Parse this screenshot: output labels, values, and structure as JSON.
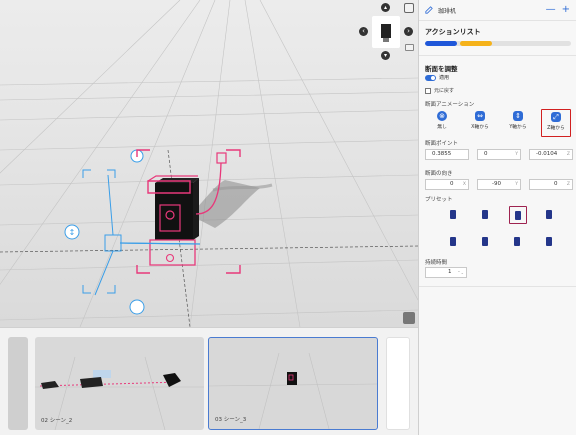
{
  "header": {
    "object_name": "珈琲机",
    "minus_label": "—",
    "plus_label": "+"
  },
  "action_list": {
    "title": "アクションリスト",
    "segment1": 0.22,
    "segment2": 0.22
  },
  "section": {
    "title": "断面を調整",
    "apply_label": "適用",
    "apply_on": true,
    "reset_label": "元に戻す",
    "animation_label": "断面アニメーション",
    "animations": [
      {
        "label": "無し",
        "icon": "none-icon"
      },
      {
        "label": "X軸から",
        "icon": "x-axis-icon"
      },
      {
        "label": "Y軸から",
        "icon": "y-axis-icon"
      },
      {
        "label": "Z軸から",
        "icon": "z-axis-icon",
        "selected": true
      }
    ],
    "point_label": "断面ポイント",
    "point": [
      {
        "value": "0.3855",
        "unit": ""
      },
      {
        "value": "0",
        "unit": "Y"
      },
      {
        "value": "-0.0104",
        "unit": "Z"
      }
    ],
    "direction_label": "断面の向き",
    "direction": [
      {
        "value": "0",
        "unit": "X"
      },
      {
        "value": "-90",
        "unit": "Y"
      },
      {
        "value": "0",
        "unit": "Z"
      }
    ],
    "preset_label": "プリセット",
    "preset_selected_index": 2,
    "duration_label": "持続時間",
    "duration_value": "1"
  },
  "scenes": [
    {
      "label": ""
    },
    {
      "label": "02 シーン_2"
    },
    {
      "label": "03 シーン_3",
      "selected": true
    },
    {
      "label": ""
    }
  ],
  "colors": {
    "accent": "#2f6cd6",
    "magenta": "#e8387a",
    "cyan": "#3a9ee8",
    "selected_red": "#d12020"
  }
}
